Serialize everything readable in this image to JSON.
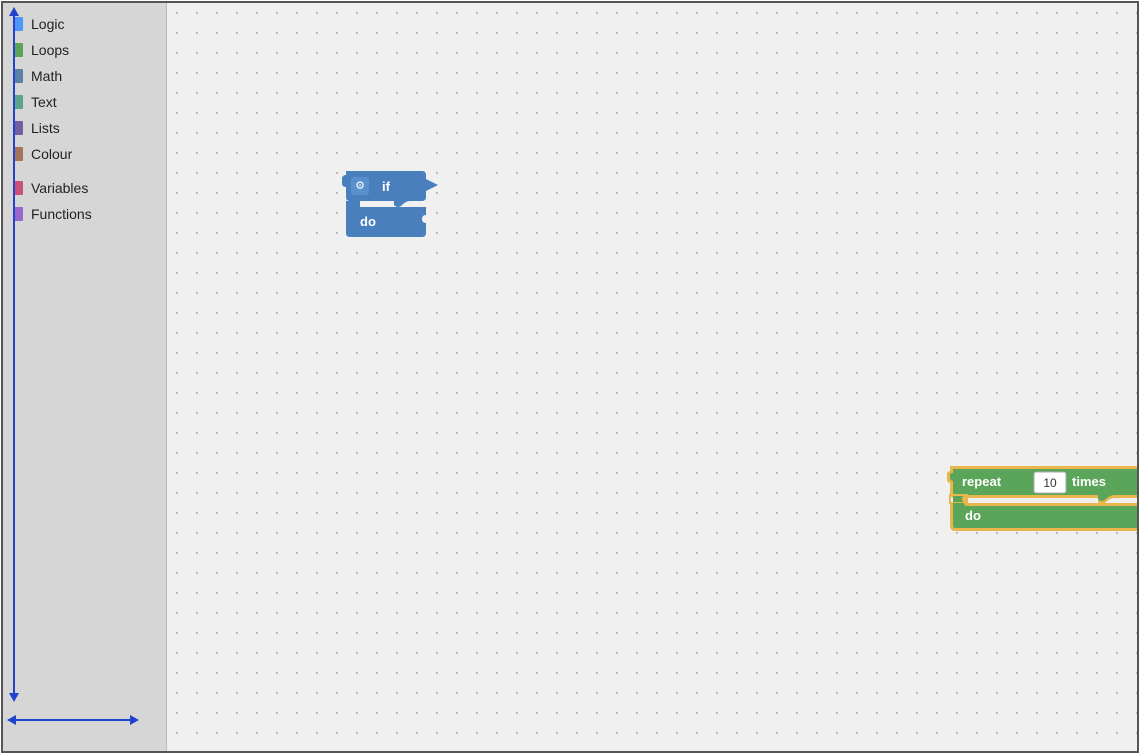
{
  "sidebar": {
    "items": [
      {
        "id": "logic",
        "label": "Logic",
        "color": "#4d97ff"
      },
      {
        "id": "loops",
        "label": "Loops",
        "color": "#5ba55b"
      },
      {
        "id": "math",
        "label": "Math",
        "color": "#5c81a6"
      },
      {
        "id": "text",
        "label": "Text",
        "color": "#5ba58c"
      },
      {
        "id": "lists",
        "label": "Lists",
        "color": "#745ca1"
      },
      {
        "id": "colour",
        "label": "Colour",
        "color": "#a5745c"
      }
    ],
    "extra_items": [
      {
        "id": "variables",
        "label": "Variables",
        "color": "#c9517a"
      },
      {
        "id": "functions",
        "label": "Functions",
        "color": "#9966cc"
      }
    ]
  },
  "blocks": {
    "if_block": {
      "top_label": "if",
      "bottom_label": "do"
    },
    "repeat_block": {
      "top_label": "repeat",
      "input_value": "10",
      "times_label": "times",
      "bottom_label": "do"
    }
  }
}
